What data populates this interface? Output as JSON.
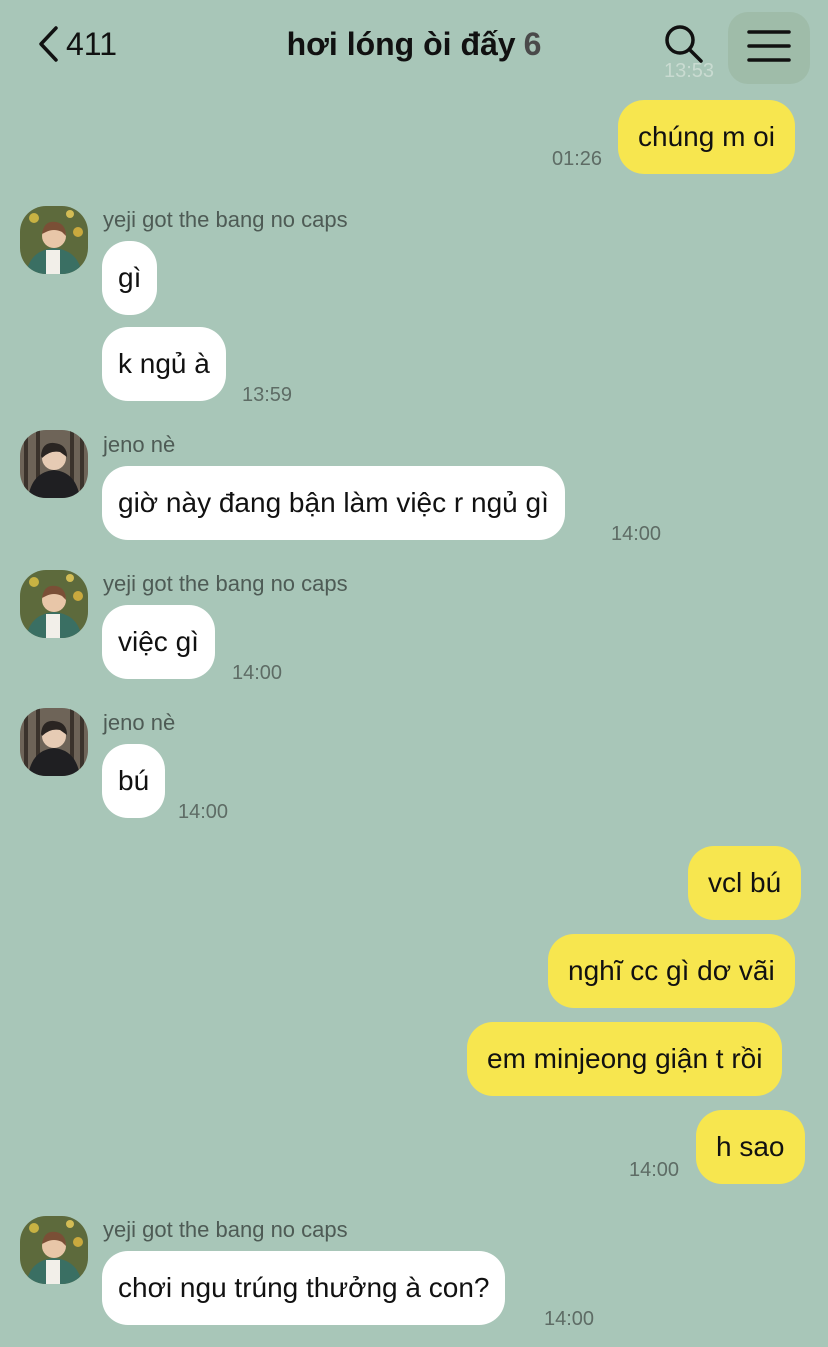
{
  "header": {
    "back_count": "411",
    "title": "hơi lóng òi đấy",
    "member_count": "6",
    "ghost_time": "13:53"
  },
  "icons": {
    "back": "chevron-left-icon",
    "search": "search-icon",
    "menu": "hamburger-menu-icon"
  },
  "colors": {
    "background": "#a8c6b8",
    "outgoing_bubble": "#f7e64f",
    "incoming_bubble": "#ffffff"
  },
  "messages": [
    {
      "direction": "out",
      "text": "chúng m oi",
      "time": "01:26"
    },
    {
      "direction": "in",
      "sender": "yeji got the bang no caps",
      "text": "gì"
    },
    {
      "direction": "in",
      "text": "k ngủ à",
      "time": "13:59"
    },
    {
      "direction": "in",
      "sender": "jeno nè",
      "text": "giờ này đang bận làm việc r ngủ gì",
      "time": "14:00"
    },
    {
      "direction": "in",
      "sender": "yeji got the bang no caps",
      "text": "việc gì",
      "time": "14:00"
    },
    {
      "direction": "in",
      "sender": "jeno nè",
      "text": "bú",
      "time": "14:00"
    },
    {
      "direction": "out",
      "text": "vcl bú"
    },
    {
      "direction": "out",
      "text": "nghĩ cc gì dơ vãi"
    },
    {
      "direction": "out",
      "text": "em minjeong giận t rồi"
    },
    {
      "direction": "out",
      "text": "h sao",
      "time": "14:00"
    },
    {
      "direction": "in",
      "sender": "yeji got the bang no caps",
      "text": "chơi ngu trúng thưởng à con?",
      "time": "14:00"
    }
  ]
}
